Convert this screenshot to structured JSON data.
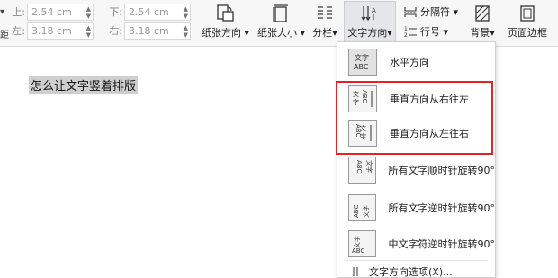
{
  "ribbon": {
    "left_edge_top": "▾",
    "left_edge_bottom": "距",
    "margins": {
      "top_label": "上:",
      "top_value": "2.54 cm",
      "bottom_label": "下:",
      "bottom_value": "2.54 cm",
      "left_label": "左:",
      "left_value": "3.18 cm",
      "right_label": "右:",
      "right_value": "3.18 cm"
    },
    "orientation_label": "纸张方向",
    "size_label": "纸张大小",
    "columns_label": "分栏",
    "text_direction_label": "文字方向",
    "breaks_label": "分隔符",
    "line_num_label": "行号",
    "background_label": "背景",
    "page_border_label": "页面边框"
  },
  "document": {
    "selected_text": "怎么让文字竖着排版"
  },
  "text_direction_menu": {
    "items": [
      {
        "label": "水平方向",
        "icon": "horizontal-text-icon"
      },
      {
        "label": "垂直方向从右往左",
        "icon": "vertical-rtl-icon"
      },
      {
        "label": "垂直方向从左往右",
        "icon": "vertical-ltr-icon"
      },
      {
        "label": "所有文字顺时针旋转90°",
        "icon": "rotate-cw-icon"
      },
      {
        "label": "所有文字逆时针旋转90°",
        "icon": "rotate-ccw-icon"
      },
      {
        "label": "中文字符逆时针旋转90°",
        "icon": "cjk-rotate-ccw-icon"
      }
    ],
    "options_label": "文字方向选项(X)..."
  },
  "colors": {
    "highlight_border": "#e32424",
    "selection_bg": "#cfcfcf",
    "active_button_bg": "#e4e6ea"
  }
}
